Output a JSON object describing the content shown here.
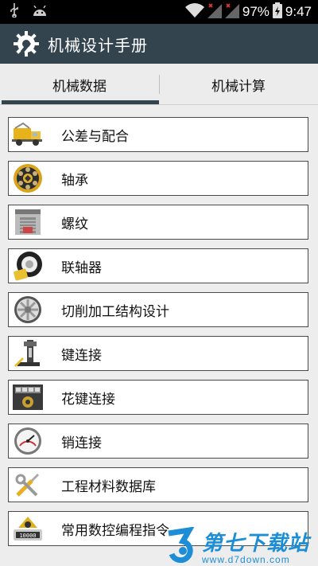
{
  "status_bar": {
    "battery_percent": "97%",
    "time": "9:47",
    "icons": [
      "usb-icon",
      "android-icon",
      "wifi-icon",
      "signal-icon",
      "signal-icon",
      "battery-charging-icon"
    ]
  },
  "app_bar": {
    "title": "机械设计手册",
    "icon": "gear-wrench-icon",
    "color": "#33444f"
  },
  "tabs": [
    {
      "label": "机械数据",
      "selected": true
    },
    {
      "label": "机械计算",
      "selected": false
    }
  ],
  "menu_items": [
    {
      "label": "公差与配合",
      "icon": "truck-icon"
    },
    {
      "label": "轴承",
      "icon": "bearing-icon"
    },
    {
      "label": "螺纹",
      "icon": "factory-icon"
    },
    {
      "label": "联轴器",
      "icon": "tire-icon"
    },
    {
      "label": "切削加工结构设计",
      "icon": "wheel-icon"
    },
    {
      "label": "键连接",
      "icon": "machine-tool-icon"
    },
    {
      "label": "花键连接",
      "icon": "panel-icon"
    },
    {
      "label": "销连接",
      "icon": "gauge-icon"
    },
    {
      "label": "工程材料数据库",
      "icon": "tools-icon"
    },
    {
      "label": "常用数控编程指令",
      "icon": "counter-icon"
    }
  ],
  "watermark": {
    "text": "第七下载站",
    "url": "www.d7down.com"
  }
}
